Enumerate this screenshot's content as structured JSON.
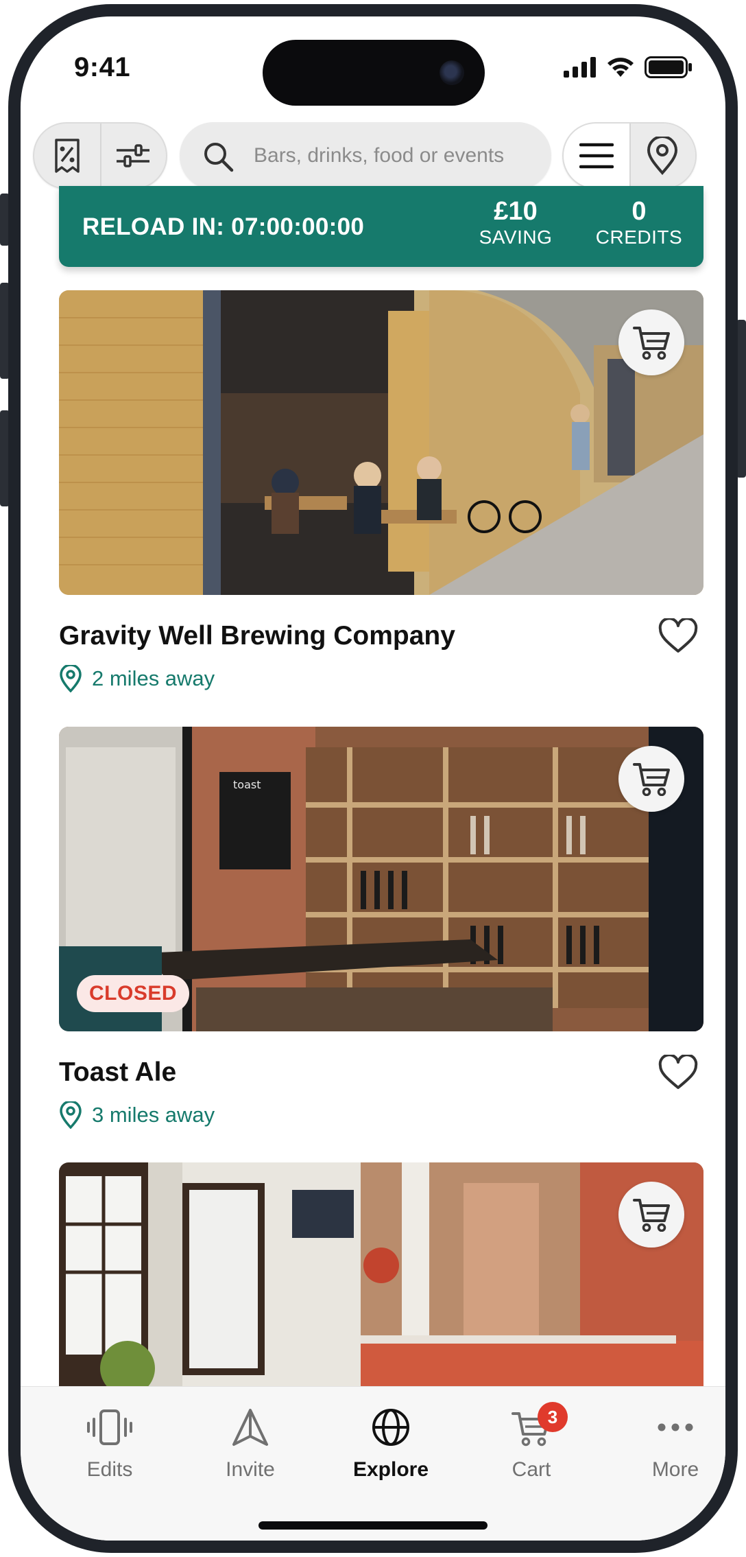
{
  "status": {
    "time": "9:41"
  },
  "search": {
    "placeholder": "Bars, drinks, food or events"
  },
  "banner": {
    "reload_text": "RELOAD IN: 07:00:00:00",
    "saving_value": "£10",
    "saving_label": "SAVING",
    "credits_value": "0",
    "credits_label": "CREDITS"
  },
  "venues": [
    {
      "name": "Gravity Well Brewing Company",
      "distance": "2 miles away",
      "closed": false
    },
    {
      "name": "Toast Ale",
      "distance": "3 miles away",
      "closed": true,
      "closed_label": "CLOSED"
    },
    {
      "name": "",
      "distance": "",
      "closed": false
    }
  ],
  "tabs": [
    {
      "label": "Edits",
      "icon": "phone-vibrate-icon",
      "active": false
    },
    {
      "label": "Invite",
      "icon": "send-triangle-icon",
      "active": false
    },
    {
      "label": "Explore",
      "icon": "globe-icon",
      "active": true
    },
    {
      "label": "Cart",
      "icon": "cart-icon",
      "active": false,
      "badge": "3"
    },
    {
      "label": "More",
      "icon": "more-dots-icon",
      "active": false
    }
  ],
  "colors": {
    "accent": "#167a6c",
    "closed": "#d93b2b",
    "badge": "#e03a2c"
  }
}
